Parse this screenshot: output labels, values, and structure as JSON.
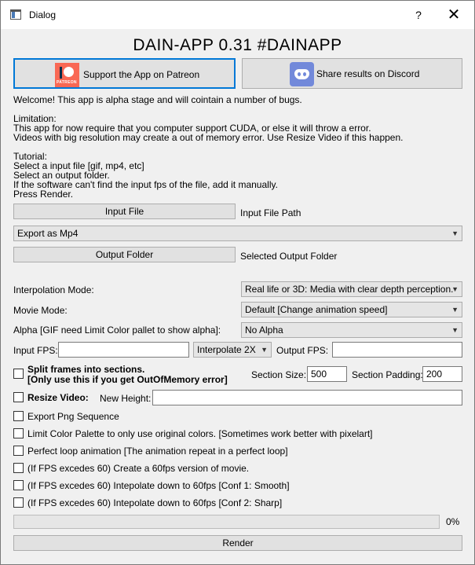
{
  "window": {
    "title": "Dialog",
    "help_label": "?",
    "close_label": "✕"
  },
  "heading": "DAIN-APP 0.31 #DAINAPP",
  "patreon_button": {
    "label": "Support the App on Patreon",
    "logo_text": "PATREON"
  },
  "discord_button": {
    "label": "Share results on Discord"
  },
  "info": {
    "welcome": "Welcome! This app is alpha stage and will cointain a number of bugs.",
    "limitation_title": "Limitation:",
    "limitation_1": "This app for now require that you computer support CUDA, or else it will throw a error.",
    "limitation_2": "Videos with big resolution may create a out of memory error. Use Resize Video if this happen.",
    "tutorial_title": "Tutorial:",
    "tutorial_1": "Select a input file [gif, mp4, etc]",
    "tutorial_2": "Select an output folder.",
    "tutorial_3": "If the software can't find the input fps of the file, add it manually.",
    "tutorial_4": "Press Render."
  },
  "input_file": {
    "button_label": "Input File",
    "path_label": "Input File Path"
  },
  "export_combo": {
    "selected": "Export as Mp4"
  },
  "output_folder": {
    "button_label": "Output Folder",
    "path_label": "Selected Output Folder"
  },
  "interpolation_mode": {
    "label": "Interpolation Mode:",
    "selected": "Real life or 3D: Media with clear depth perception."
  },
  "movie_mode": {
    "label": "Movie Mode:",
    "selected": "Default [Change animation speed]"
  },
  "alpha": {
    "label": "Alpha [GIF need Limit Color pallet to show alpha]:",
    "selected": "No Alpha"
  },
  "fps_row": {
    "input_label": "Input FPS:",
    "input_value": "",
    "interpolate_selected": "Interpolate 2X",
    "output_label": "Output FPS:",
    "output_value": ""
  },
  "split_frames": {
    "label_line1": "Split frames into sections.",
    "label_line2": "[Only use this if you get OutOfMemory error]",
    "section_size_label": "Section Size:",
    "section_size_value": "500",
    "section_padding_label": "Section Padding:",
    "section_padding_value": "200"
  },
  "resize_video": {
    "label": "Resize Video:",
    "new_height_label": "New Height:",
    "new_height_value": ""
  },
  "options": [
    {
      "label": "Export Png Sequence",
      "checked": false
    },
    {
      "label": "Limit Color Palette to only use original colors. [Sometimes work better with pixelart]",
      "checked": false
    },
    {
      "label": "Perfect loop animation [The animation repeat in a perfect loop]",
      "checked": false
    },
    {
      "label": "(If FPS excedes 60) Create a 60fps version of movie.",
      "checked": false
    },
    {
      "label": "(If FPS excedes 60) Intepolate down to 60fps [Conf 1: Smooth]",
      "checked": false
    },
    {
      "label": "(If FPS excedes 60) Intepolate down to 60fps [Conf 2: Sharp]",
      "checked": false
    }
  ],
  "progress": {
    "value": 0,
    "text": "0%"
  },
  "render_button": {
    "label": "Render"
  },
  "colors": {
    "accent": "#0078d7",
    "patreon": "#f96854",
    "discord": "#7289da"
  }
}
